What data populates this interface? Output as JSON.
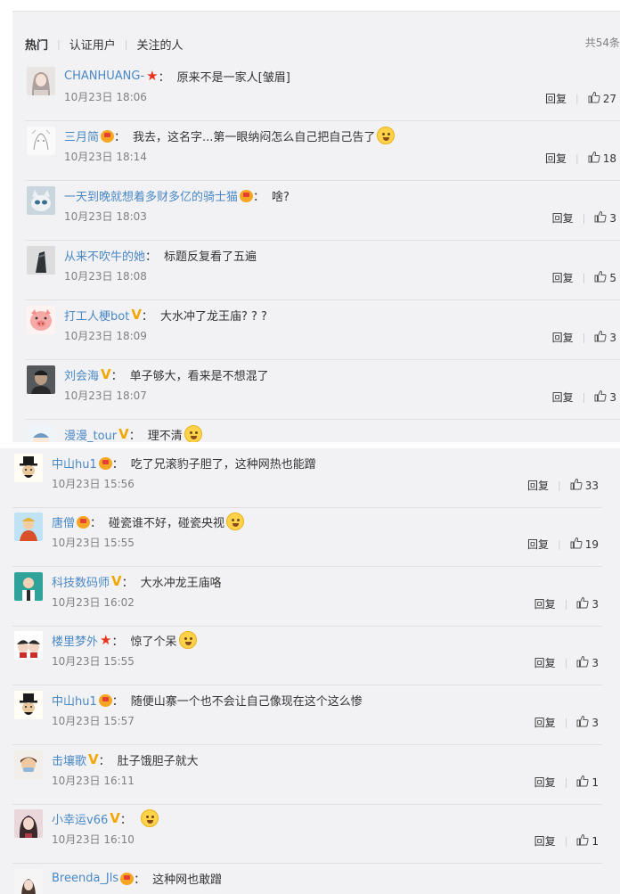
{
  "tabs": [
    "热门",
    "认证用户",
    "关注的人"
  ],
  "total": "共54条",
  "reply_label": "回复",
  "colors": {
    "username": "#4a88c4",
    "vbadge": "#f2a600",
    "star": "#e8341c"
  },
  "top_comments": [
    {
      "user": "CHANHUANG-",
      "badge": "star",
      "text": "原来不是一家人[皱眉]",
      "time": "10月23日 18:06",
      "likes": "27",
      "avatar": "girl-avatar",
      "emoji": false
    },
    {
      "user": "三月简",
      "badge": "crown",
      "text": "我去，这名字...第一眼纳闷怎么自己把自己告了",
      "time": "10月23日 18:14",
      "likes": "18",
      "avatar": "sketch-avatar",
      "emoji": true
    },
    {
      "user": "一天到晚就想着多财多亿的骑士猫",
      "badge": "crown",
      "text": "啥?",
      "time": "10月23日 18:03",
      "likes": "3",
      "avatar": "cat-avatar",
      "emoji": false
    },
    {
      "user": "从来不吹牛的她",
      "badge": "",
      "text": "标题反复看了五遍",
      "time": "10月23日 18:08",
      "likes": "5",
      "avatar": "dark-avatar",
      "emoji": false
    },
    {
      "user": "打工人梗bot",
      "badge": "v",
      "text": "大水冲了龙王庙? ? ?",
      "time": "10月23日 18:09",
      "likes": "3",
      "avatar": "pig-avatar",
      "emoji": false
    },
    {
      "user": "刘会海",
      "badge": "v",
      "text": "单子够大，看来是不想混了",
      "time": "10月23日 18:07",
      "likes": "3",
      "avatar": "man-avatar",
      "emoji": false
    },
    {
      "user": "漫漫_tour",
      "badge": "v",
      "text": "理不清",
      "time": "",
      "likes": "",
      "avatar": "cartoon-avatar",
      "emoji": true
    }
  ],
  "bottom_comments": [
    {
      "user": "中山hu1",
      "badge": "crown",
      "text": "吃了兄滚豹子胆了，这种网热也能蹭",
      "time": "10月23日 15:56",
      "likes": "33",
      "avatar": "hat-avatar",
      "emoji": false
    },
    {
      "user": "唐僧",
      "badge": "crown",
      "text": "碰瓷谁不好，碰瓷央视",
      "time": "10月23日 15:55",
      "likes": "19",
      "avatar": "monk-avatar",
      "emoji": true
    },
    {
      "user": "科技数码师",
      "badge": "v",
      "text": "大水冲龙王庙咯",
      "time": "10月23日 16:02",
      "likes": "3",
      "avatar": "tech-avatar",
      "emoji": false
    },
    {
      "user": "楼里梦外",
      "badge": "star",
      "text": "惊了个呆",
      "time": "10月23日 15:55",
      "likes": "3",
      "avatar": "anime-avatar",
      "emoji": true
    },
    {
      "user": "中山hu1",
      "badge": "crown",
      "text": "随便山寨一个也不会让自己像现在这个这么惨",
      "time": "10月23日 15:57",
      "likes": "3",
      "avatar": "hat-avatar",
      "emoji": false
    },
    {
      "user": "击壤歌",
      "badge": "v",
      "text": "肚子饿胆子就大",
      "time": "10月23日 16:11",
      "likes": "1",
      "avatar": "boy-avatar",
      "emoji": false
    },
    {
      "user": "小幸运v66",
      "badge": "v",
      "text": "",
      "time": "10月23日 16:10",
      "likes": "1",
      "avatar": "girl2-avatar",
      "emoji": true
    },
    {
      "user": "Breenda_Jls",
      "badge": "crown",
      "text": "这种网也敢蹭",
      "time": "",
      "likes": "",
      "avatar": "girl3-avatar",
      "emoji": false
    }
  ]
}
